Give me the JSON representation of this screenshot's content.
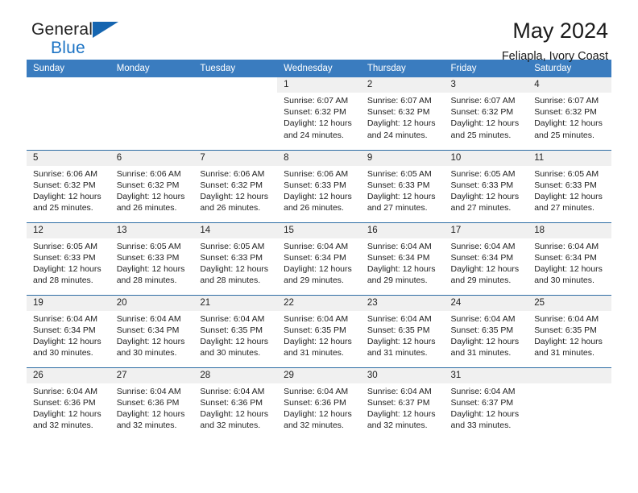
{
  "brand": {
    "line1": "General",
    "line2": "Blue",
    "flag_icon": "triangle-flag-icon",
    "accent_color": "#1b73c4"
  },
  "header": {
    "month_title": "May 2024",
    "location": "Feliapla, Ivory Coast"
  },
  "calendar": {
    "header_bg": "#3a7cbf",
    "daynum_bg": "#f0f0f0",
    "row_divider_color": "#2e6da4",
    "weekday_headers": [
      "Sunday",
      "Monday",
      "Tuesday",
      "Wednesday",
      "Thursday",
      "Friday",
      "Saturday"
    ],
    "weeks": [
      [
        {
          "blank": true
        },
        {
          "blank": true
        },
        {
          "blank": true
        },
        {
          "day": "1",
          "sunrise": "Sunrise: 6:07 AM",
          "sunset": "Sunset: 6:32 PM",
          "daylight": "Daylight: 12 hours and 24 minutes."
        },
        {
          "day": "2",
          "sunrise": "Sunrise: 6:07 AM",
          "sunset": "Sunset: 6:32 PM",
          "daylight": "Daylight: 12 hours and 24 minutes."
        },
        {
          "day": "3",
          "sunrise": "Sunrise: 6:07 AM",
          "sunset": "Sunset: 6:32 PM",
          "daylight": "Daylight: 12 hours and 25 minutes."
        },
        {
          "day": "4",
          "sunrise": "Sunrise: 6:07 AM",
          "sunset": "Sunset: 6:32 PM",
          "daylight": "Daylight: 12 hours and 25 minutes."
        }
      ],
      [
        {
          "day": "5",
          "sunrise": "Sunrise: 6:06 AM",
          "sunset": "Sunset: 6:32 PM",
          "daylight": "Daylight: 12 hours and 25 minutes."
        },
        {
          "day": "6",
          "sunrise": "Sunrise: 6:06 AM",
          "sunset": "Sunset: 6:32 PM",
          "daylight": "Daylight: 12 hours and 26 minutes."
        },
        {
          "day": "7",
          "sunrise": "Sunrise: 6:06 AM",
          "sunset": "Sunset: 6:32 PM",
          "daylight": "Daylight: 12 hours and 26 minutes."
        },
        {
          "day": "8",
          "sunrise": "Sunrise: 6:06 AM",
          "sunset": "Sunset: 6:33 PM",
          "daylight": "Daylight: 12 hours and 26 minutes."
        },
        {
          "day": "9",
          "sunrise": "Sunrise: 6:05 AM",
          "sunset": "Sunset: 6:33 PM",
          "daylight": "Daylight: 12 hours and 27 minutes."
        },
        {
          "day": "10",
          "sunrise": "Sunrise: 6:05 AM",
          "sunset": "Sunset: 6:33 PM",
          "daylight": "Daylight: 12 hours and 27 minutes."
        },
        {
          "day": "11",
          "sunrise": "Sunrise: 6:05 AM",
          "sunset": "Sunset: 6:33 PM",
          "daylight": "Daylight: 12 hours and 27 minutes."
        }
      ],
      [
        {
          "day": "12",
          "sunrise": "Sunrise: 6:05 AM",
          "sunset": "Sunset: 6:33 PM",
          "daylight": "Daylight: 12 hours and 28 minutes."
        },
        {
          "day": "13",
          "sunrise": "Sunrise: 6:05 AM",
          "sunset": "Sunset: 6:33 PM",
          "daylight": "Daylight: 12 hours and 28 minutes."
        },
        {
          "day": "14",
          "sunrise": "Sunrise: 6:05 AM",
          "sunset": "Sunset: 6:33 PM",
          "daylight": "Daylight: 12 hours and 28 minutes."
        },
        {
          "day": "15",
          "sunrise": "Sunrise: 6:04 AM",
          "sunset": "Sunset: 6:34 PM",
          "daylight": "Daylight: 12 hours and 29 minutes."
        },
        {
          "day": "16",
          "sunrise": "Sunrise: 6:04 AM",
          "sunset": "Sunset: 6:34 PM",
          "daylight": "Daylight: 12 hours and 29 minutes."
        },
        {
          "day": "17",
          "sunrise": "Sunrise: 6:04 AM",
          "sunset": "Sunset: 6:34 PM",
          "daylight": "Daylight: 12 hours and 29 minutes."
        },
        {
          "day": "18",
          "sunrise": "Sunrise: 6:04 AM",
          "sunset": "Sunset: 6:34 PM",
          "daylight": "Daylight: 12 hours and 30 minutes."
        }
      ],
      [
        {
          "day": "19",
          "sunrise": "Sunrise: 6:04 AM",
          "sunset": "Sunset: 6:34 PM",
          "daylight": "Daylight: 12 hours and 30 minutes."
        },
        {
          "day": "20",
          "sunrise": "Sunrise: 6:04 AM",
          "sunset": "Sunset: 6:34 PM",
          "daylight": "Daylight: 12 hours and 30 minutes."
        },
        {
          "day": "21",
          "sunrise": "Sunrise: 6:04 AM",
          "sunset": "Sunset: 6:35 PM",
          "daylight": "Daylight: 12 hours and 30 minutes."
        },
        {
          "day": "22",
          "sunrise": "Sunrise: 6:04 AM",
          "sunset": "Sunset: 6:35 PM",
          "daylight": "Daylight: 12 hours and 31 minutes."
        },
        {
          "day": "23",
          "sunrise": "Sunrise: 6:04 AM",
          "sunset": "Sunset: 6:35 PM",
          "daylight": "Daylight: 12 hours and 31 minutes."
        },
        {
          "day": "24",
          "sunrise": "Sunrise: 6:04 AM",
          "sunset": "Sunset: 6:35 PM",
          "daylight": "Daylight: 12 hours and 31 minutes."
        },
        {
          "day": "25",
          "sunrise": "Sunrise: 6:04 AM",
          "sunset": "Sunset: 6:35 PM",
          "daylight": "Daylight: 12 hours and 31 minutes."
        }
      ],
      [
        {
          "day": "26",
          "sunrise": "Sunrise: 6:04 AM",
          "sunset": "Sunset: 6:36 PM",
          "daylight": "Daylight: 12 hours and 32 minutes."
        },
        {
          "day": "27",
          "sunrise": "Sunrise: 6:04 AM",
          "sunset": "Sunset: 6:36 PM",
          "daylight": "Daylight: 12 hours and 32 minutes."
        },
        {
          "day": "28",
          "sunrise": "Sunrise: 6:04 AM",
          "sunset": "Sunset: 6:36 PM",
          "daylight": "Daylight: 12 hours and 32 minutes."
        },
        {
          "day": "29",
          "sunrise": "Sunrise: 6:04 AM",
          "sunset": "Sunset: 6:36 PM",
          "daylight": "Daylight: 12 hours and 32 minutes."
        },
        {
          "day": "30",
          "sunrise": "Sunrise: 6:04 AM",
          "sunset": "Sunset: 6:37 PM",
          "daylight": "Daylight: 12 hours and 32 minutes."
        },
        {
          "day": "31",
          "sunrise": "Sunrise: 6:04 AM",
          "sunset": "Sunset: 6:37 PM",
          "daylight": "Daylight: 12 hours and 33 minutes."
        },
        {
          "empty": true
        }
      ]
    ]
  }
}
